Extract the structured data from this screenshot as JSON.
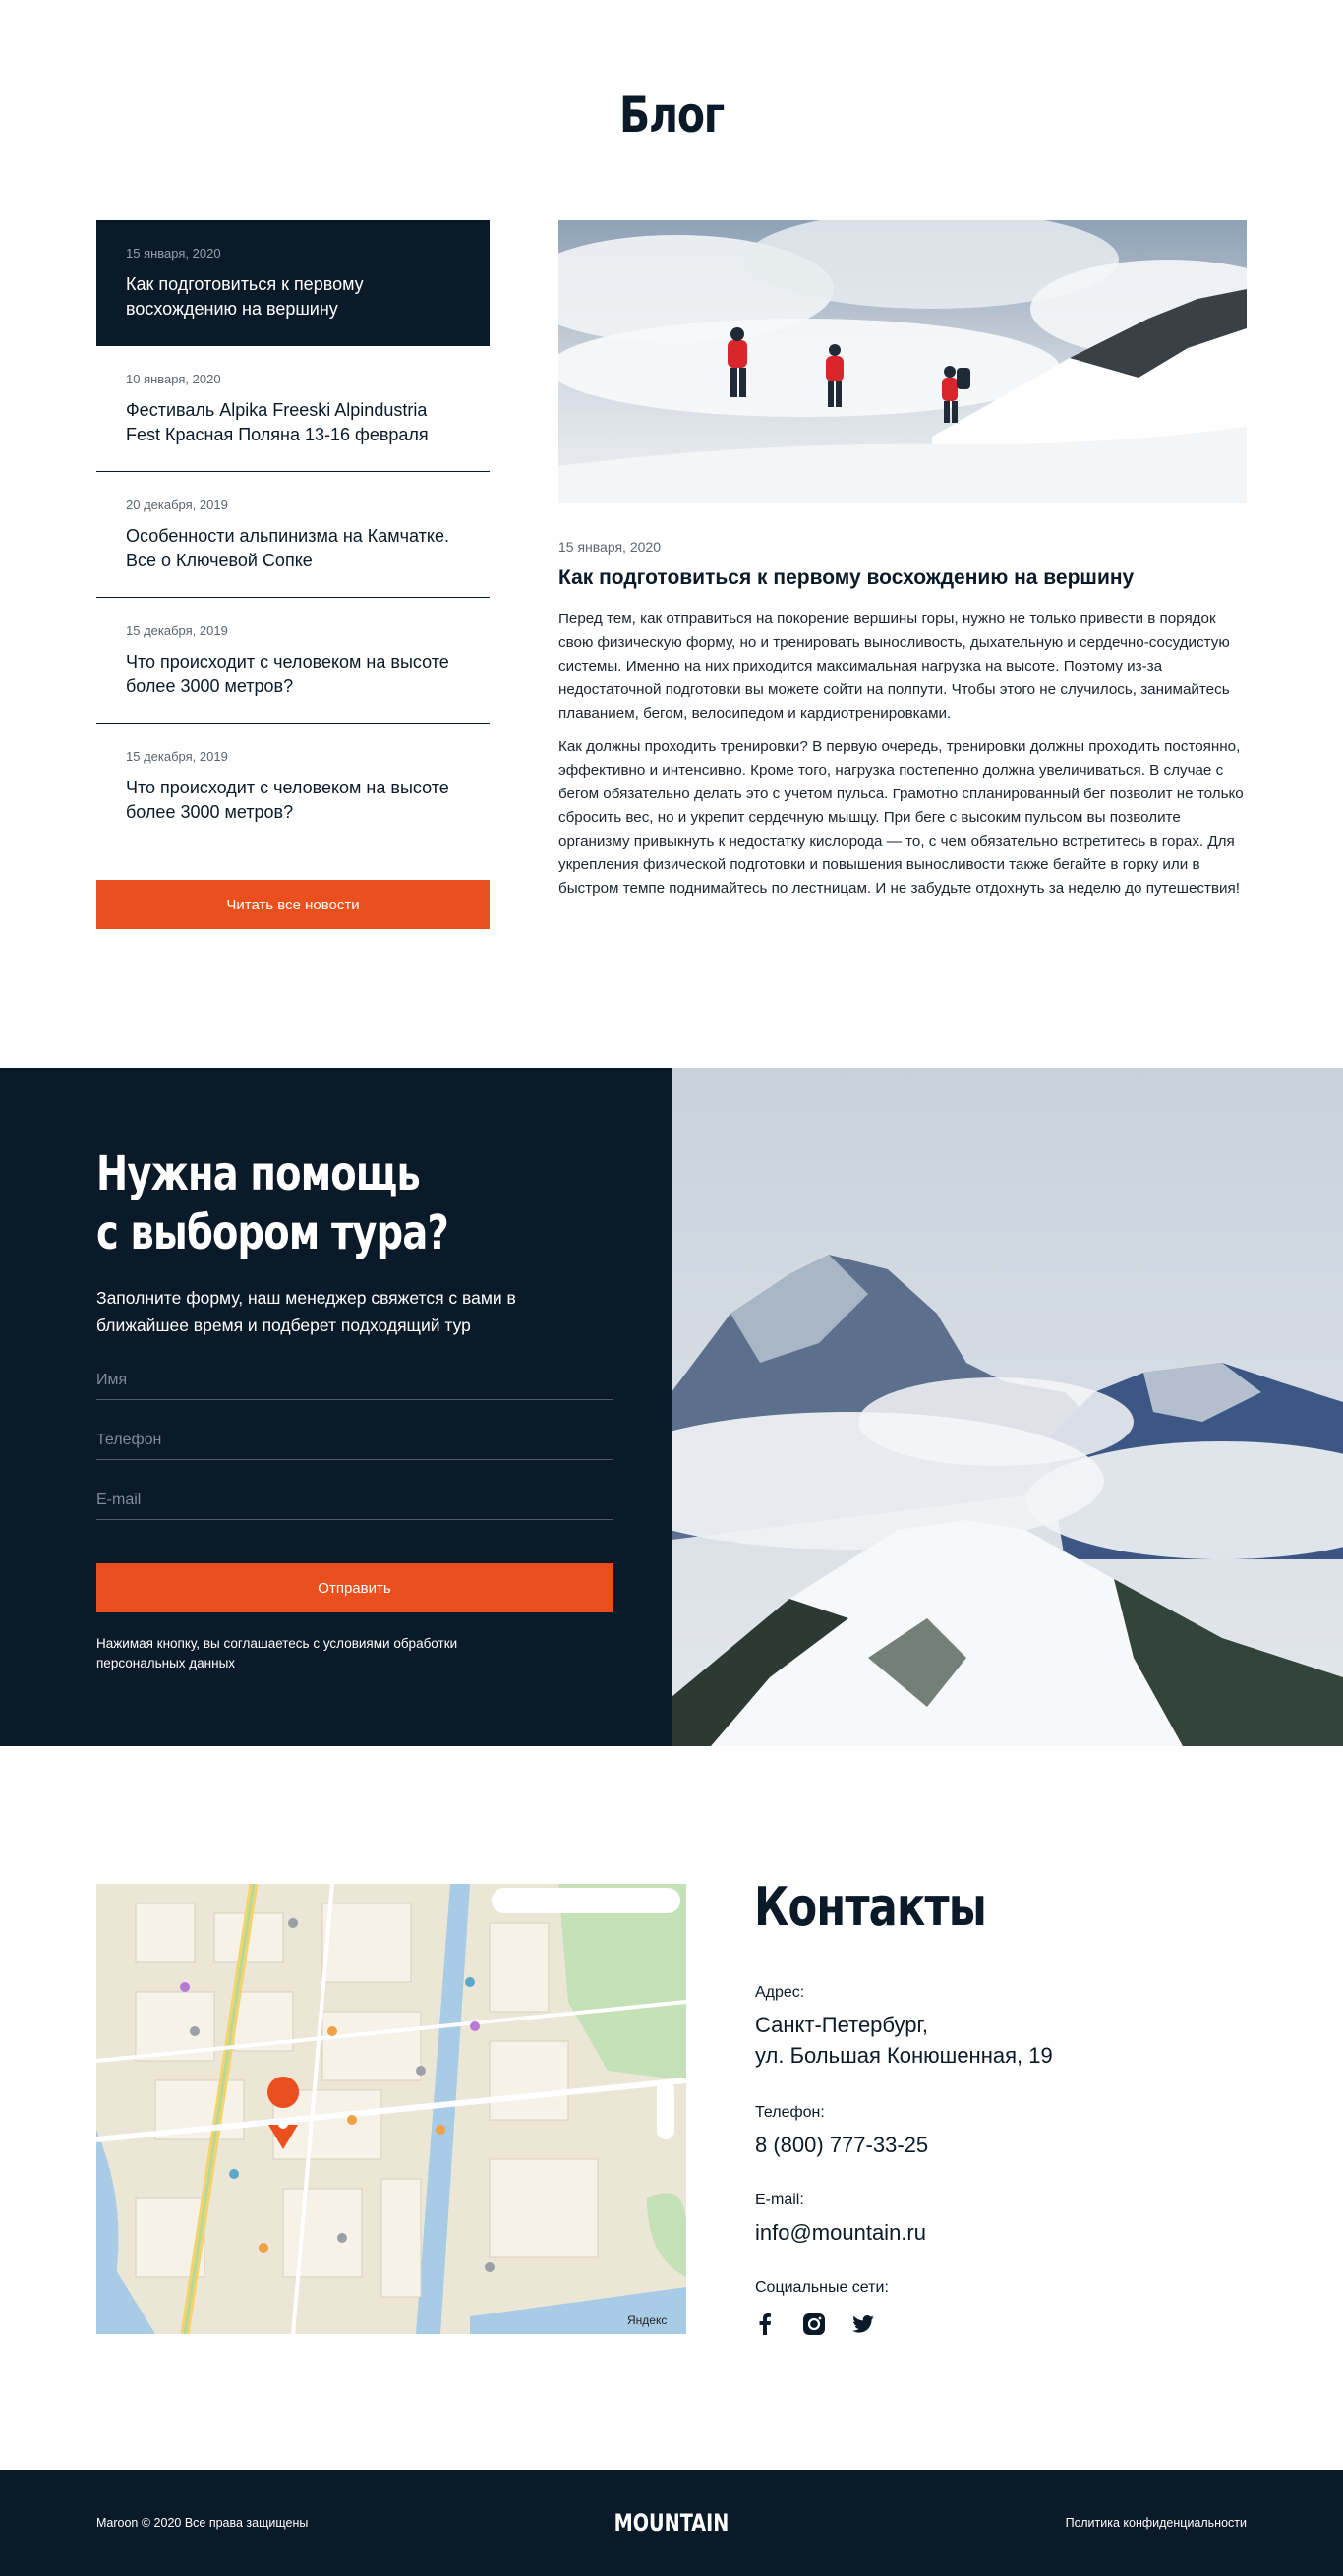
{
  "blog": {
    "title": "Блог",
    "posts": [
      {
        "date": "15 января, 2020",
        "title": "Как подготовиться к первому восхождению на вершину"
      },
      {
        "date": "10 января, 2020",
        "title": "Фестиваль Alpika Freeski Alpindustria Fest Красная Поляна 13-16 февраля"
      },
      {
        "date": "20 декабря, 2019",
        "title": "Особенности альпинизма на Камчатке. Все о Ключевой Сопке"
      },
      {
        "date": "15 декабря, 2019",
        "title": "Что происходит с человеком на высоте более 3000 метров?"
      },
      {
        "date": "15 декабря, 2019",
        "title": "Что происходит с человеком на высоте более 3000 метров?"
      }
    ],
    "read_all_label": "Читать все новости",
    "article": {
      "date": "15 января, 2020",
      "title": "Как подготовиться к первому восхождению на вершину",
      "paragraphs": [
        "Перед тем, как отправиться на покорение вершины горы, нужно не только привести в порядок свою физическую форму, но и тренировать выносливость, дыхательную и сердечно-сосудистую системы. Именно на них приходится максимальная нагрузка на высоте. Поэтому из-за недостаточной подготовки вы можете сойти на полпути. Чтобы этого не случилось, занимайтесь плаванием, бегом, велосипедом и кардиотренировками.",
        "Как должны проходить тренировки? В первую очередь, тренировки должны проходить постоянно, эффективно и интенсивно. Кроме того, нагрузка постепенно должна увеличиваться. В случае с бегом обязательно делать это с учетом пульса. Грамотно спланированный бег позволит не только сбросить вес, но и укрепит сердечную мышцу. При беге с высоким пульсом вы позволите организму привыкнуть к недостатку кислорода — то, с чем обязательно встретитесь в горах. Для укрепления физической подготовки и повышения выносливости также бегайте в горку или в быстром темпе поднимайтесь по лестницам. И не забудьте отдохнуть за неделю до путешествия!"
      ]
    }
  },
  "help": {
    "title_line1": "Нужна помощь",
    "title_line2": "с выбором тура?",
    "subtitle": "Заполните форму, наш менеджер свяжется с вами в ближайшее время и подберет подходящий тур",
    "name_placeholder": "Имя",
    "phone_placeholder": "Телефон",
    "email_placeholder": "E-mail",
    "submit_label": "Отправить",
    "consent": "Нажимая кнопку, вы соглашаетесь с условиями обработки персональных данных"
  },
  "contacts": {
    "title": "Контакты",
    "address_label": "Адрес:",
    "address_line1": "Санкт-Петербург,",
    "address_line2": "ул. Большая Конюшенная, 19",
    "phone_label": "Телефон:",
    "phone": "8 (800) 777-33-25",
    "email_label": "E-mail:",
    "email": "info@mountain.ru",
    "social_label": "Социальные сети:",
    "social_icons": [
      "facebook-icon",
      "instagram-icon",
      "twitter-icon"
    ],
    "map_brand": "Яндекс"
  },
  "footer": {
    "copyright": "Maroon © 2020 Все права защищены",
    "logo": "MOUNTAIN",
    "privacy": "Политика конфиденциальности"
  },
  "colors": {
    "navy": "#0b1a28",
    "accent": "#eb4f1d",
    "white": "#ffffff"
  }
}
